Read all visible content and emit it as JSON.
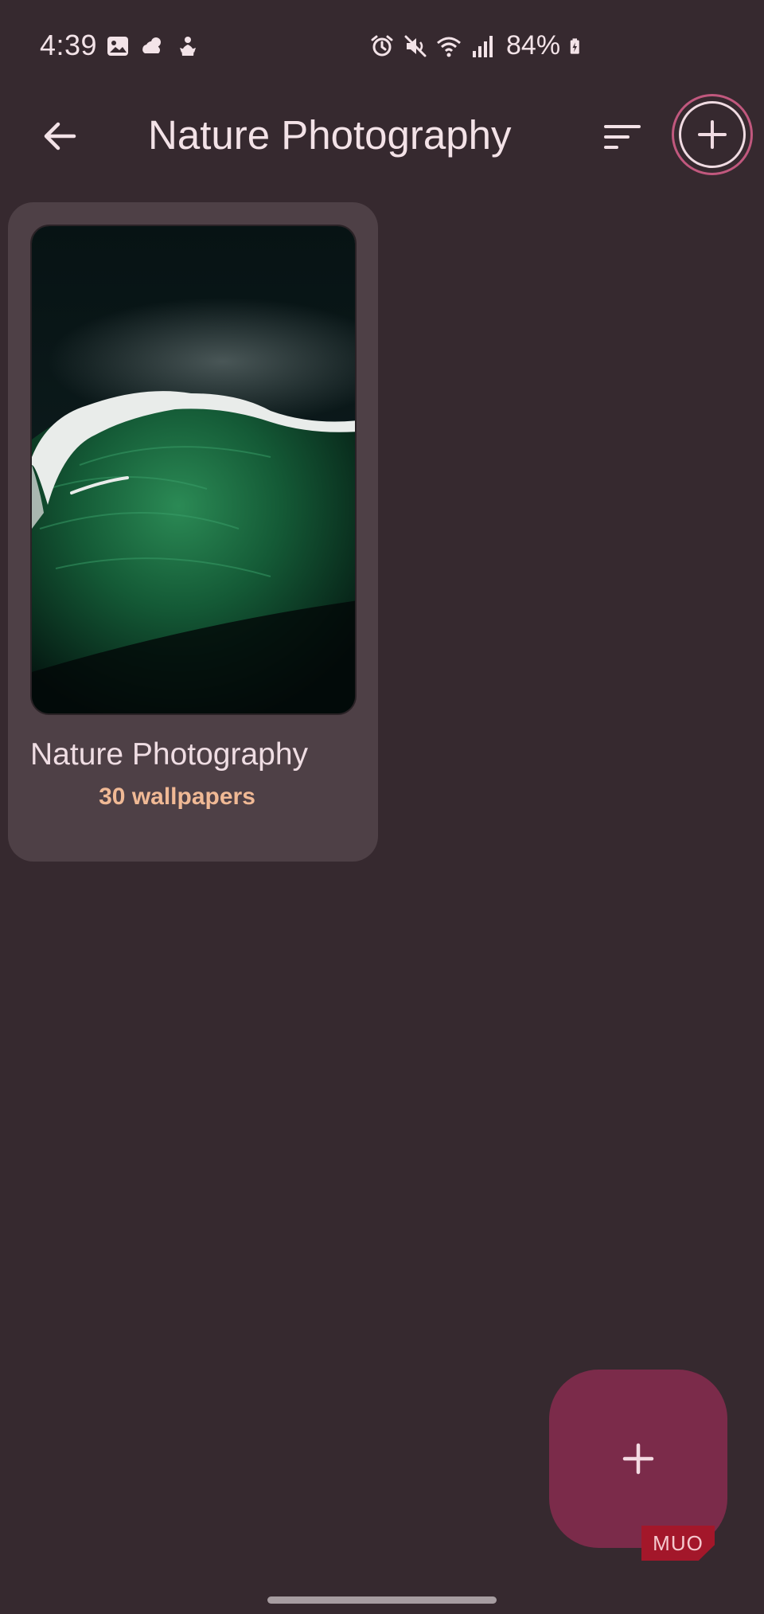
{
  "status_bar": {
    "time": "4:39",
    "battery": "84%",
    "left_icons": [
      "gallery-icon",
      "weather-icon",
      "snapdragon-icon"
    ],
    "right_icons": [
      "alarm-icon",
      "mute-icon",
      "wifi-icon",
      "signal-icon",
      "battery-charging-icon"
    ]
  },
  "app_bar": {
    "title": "Nature Photography",
    "back_icon": "arrow-back-icon",
    "sort_icon": "sort-icon",
    "add_icon": "add-circle-icon"
  },
  "albums": [
    {
      "title": "Nature Photography",
      "count": "30 wallpapers",
      "thumbnail": "green ocean wave on dark background"
    }
  ],
  "fab": {
    "icon": "plus-icon"
  },
  "watermark": {
    "text": "MUO"
  },
  "colors": {
    "background": "#36292f",
    "card": "#4e4046",
    "accent_fab": "#7b2b4a",
    "accent_ring": "#c1587e",
    "count_text": "#f0b995",
    "text": "#f1dfe4"
  }
}
